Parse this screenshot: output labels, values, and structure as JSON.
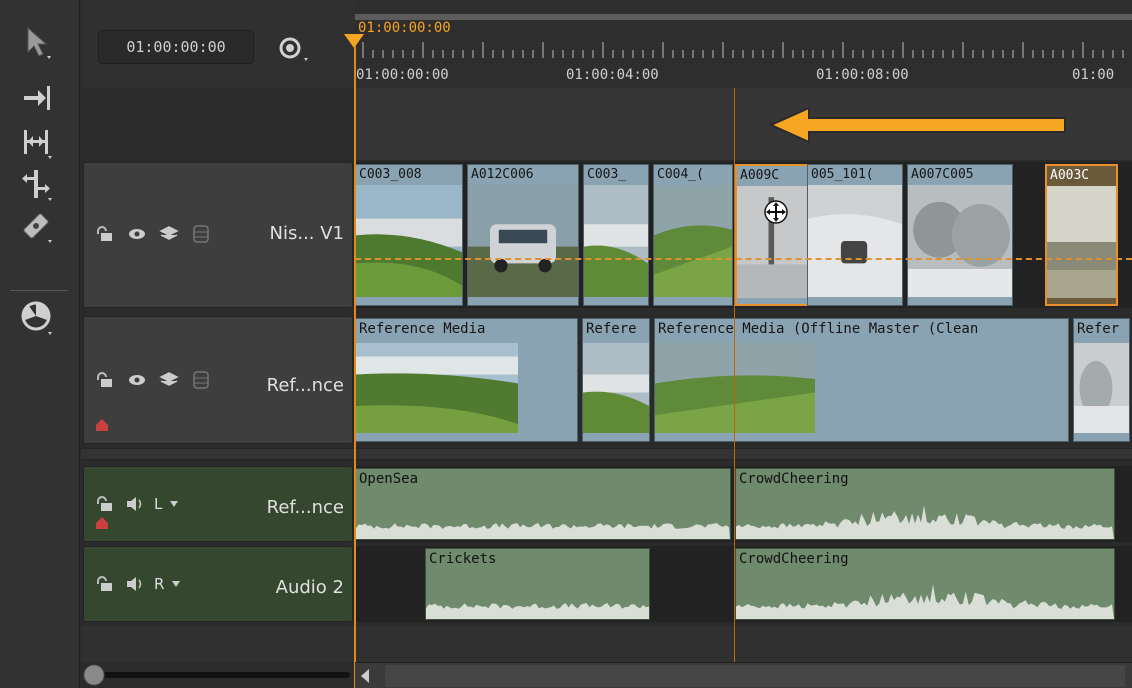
{
  "toolbar": {
    "tools": [
      {
        "name": "select-tool"
      },
      {
        "name": "move-tool"
      },
      {
        "name": "slip-tool"
      },
      {
        "name": "roll-tool"
      },
      {
        "name": "razor-tool"
      },
      {
        "name": "multi-view-tool"
      }
    ]
  },
  "header": {
    "timecode": "01:00:00:00",
    "playhead_timecode": "01:00:00:00",
    "ruler_labels": [
      "01:00:00:00",
      "01:00:04:00",
      "01:00:08:00",
      "01:00"
    ]
  },
  "tracks": {
    "video1": {
      "name": "Nis... V1",
      "clips": [
        {
          "label": "C003_008",
          "start": 0,
          "end": 110,
          "thumb": "coast"
        },
        {
          "label": "A012C006",
          "start": 112,
          "end": 226,
          "thumb": "car"
        },
        {
          "label": "C003_",
          "start": 228,
          "end": 296,
          "thumb": "coast2"
        },
        {
          "label": "C004_(",
          "start": 298,
          "end": 380,
          "thumb": "green"
        },
        {
          "label": "A009C",
          "start": 380,
          "end": 456,
          "thumb": "snowtree",
          "selected": true
        },
        {
          "label": "005_101(",
          "start": 452,
          "end": 550,
          "thumb": "snowcar"
        },
        {
          "label": "A007C005",
          "start": 552,
          "end": 660,
          "thumb": "snow"
        },
        {
          "label": "A003C",
          "start": 690,
          "end": 765,
          "thumb": "sea",
          "selected": true
        }
      ]
    },
    "reference": {
      "name": "Ref...nce",
      "clips": [
        {
          "label": "Reference Media",
          "start": 0,
          "end": 225
        },
        {
          "label": "Refere",
          "start": 227,
          "end": 297
        },
        {
          "label": "Reference Media (Offline Master (Clean",
          "start": 299,
          "end": 716
        },
        {
          "label": "Refer",
          "start": 718,
          "end": 777
        }
      ]
    },
    "audio1": {
      "name": "Ref...nce",
      "channel": "L",
      "clips": [
        {
          "label": "OpenSea",
          "start": 0,
          "end": 378
        },
        {
          "label": "CrowdCheering",
          "start": 380,
          "end": 762
        }
      ]
    },
    "audio2": {
      "name": "Audio 2",
      "channel": "R",
      "clips": [
        {
          "label": "Crickets",
          "start": 70,
          "end": 297
        },
        {
          "label": "CrowdCheering",
          "start": 380,
          "end": 762
        }
      ]
    }
  },
  "colors": {
    "accent": "#f7a521",
    "clip_video": "#8aa3b3",
    "clip_audio": "#6f8a6c",
    "audio_header": "#35472f"
  }
}
